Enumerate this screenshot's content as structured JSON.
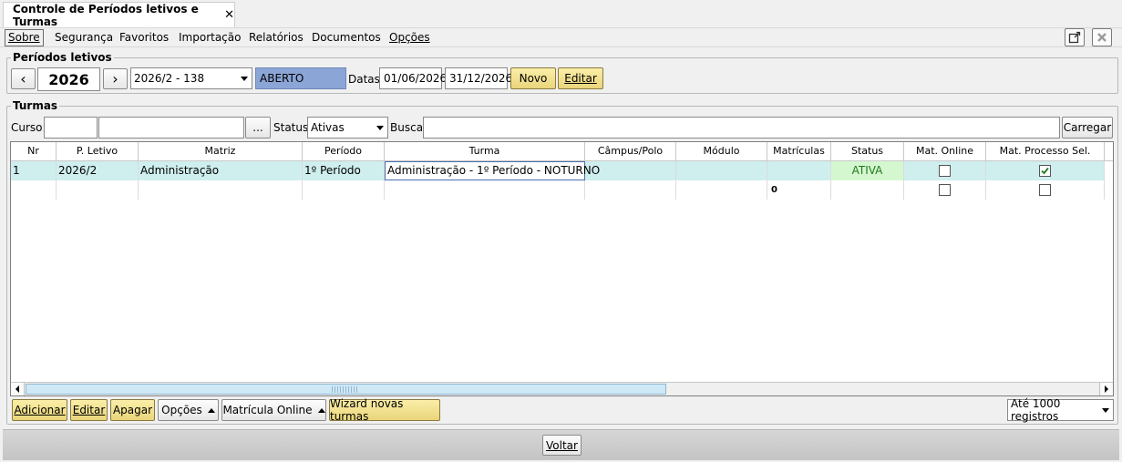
{
  "window": {
    "tab_title": "Controle de Períodos letivos e Turmas",
    "tab_close": "✕"
  },
  "menu": {
    "items": [
      "Sobre",
      "Segurança",
      "Favoritos",
      "Importação",
      "Relatórios",
      "Documentos",
      "Opções"
    ]
  },
  "periodos": {
    "legend": "Períodos letivos",
    "year": "2026",
    "period_select": "2026/2 - 138",
    "status": "ABERTO",
    "datas_label": "Datas:",
    "date_start": "01/06/2026",
    "date_end": "31/12/2026",
    "novo_label": "Novo",
    "editar_label": "Editar",
    "prev": "‹",
    "next": "›"
  },
  "turmas": {
    "legend": "Turmas",
    "curso_label": "Curso:",
    "curso_code": "",
    "curso_name": "",
    "browse_label": "...",
    "status_label": "Status:",
    "status_value": "Ativas",
    "busca_label": "Busca:",
    "busca_value": "",
    "carregar_label": "Carregar"
  },
  "grid": {
    "columns": [
      "Nr",
      "P. Letivo",
      "Matriz",
      "Período",
      "Turma",
      "Câmpus/Polo",
      "Módulo",
      "Matrículas",
      "Status",
      "Mat. Online",
      "Mat. Processo Sel."
    ],
    "rows": [
      {
        "nr": "1",
        "pletivo": "2026/2",
        "matriz": "Administração",
        "periodo": "1º Período",
        "turma": "Administração - 1º Período - NOTURNO",
        "campus": "",
        "modulo": "",
        "matriculas": "",
        "status": "ATIVA",
        "mat_online": false,
        "mat_processo": true
      }
    ],
    "total_matriculas": "0"
  },
  "actions": {
    "adicionar": "Adicionar",
    "editar": "Editar",
    "apagar": "Apagar",
    "opcoes": "Opções",
    "matricula_online": "Matrícula Online",
    "wizard": "Wizard novas turmas",
    "limit": "Até 1000 registros"
  },
  "footer": {
    "voltar": "Voltar"
  },
  "colors": {
    "status_bg": "#8ba5d6",
    "row_selected": "#cfeeee",
    "ativa_bg": "#d5f7d0",
    "ativa_text": "#1e7a1e",
    "accent_yellow": "#f1df8e"
  }
}
